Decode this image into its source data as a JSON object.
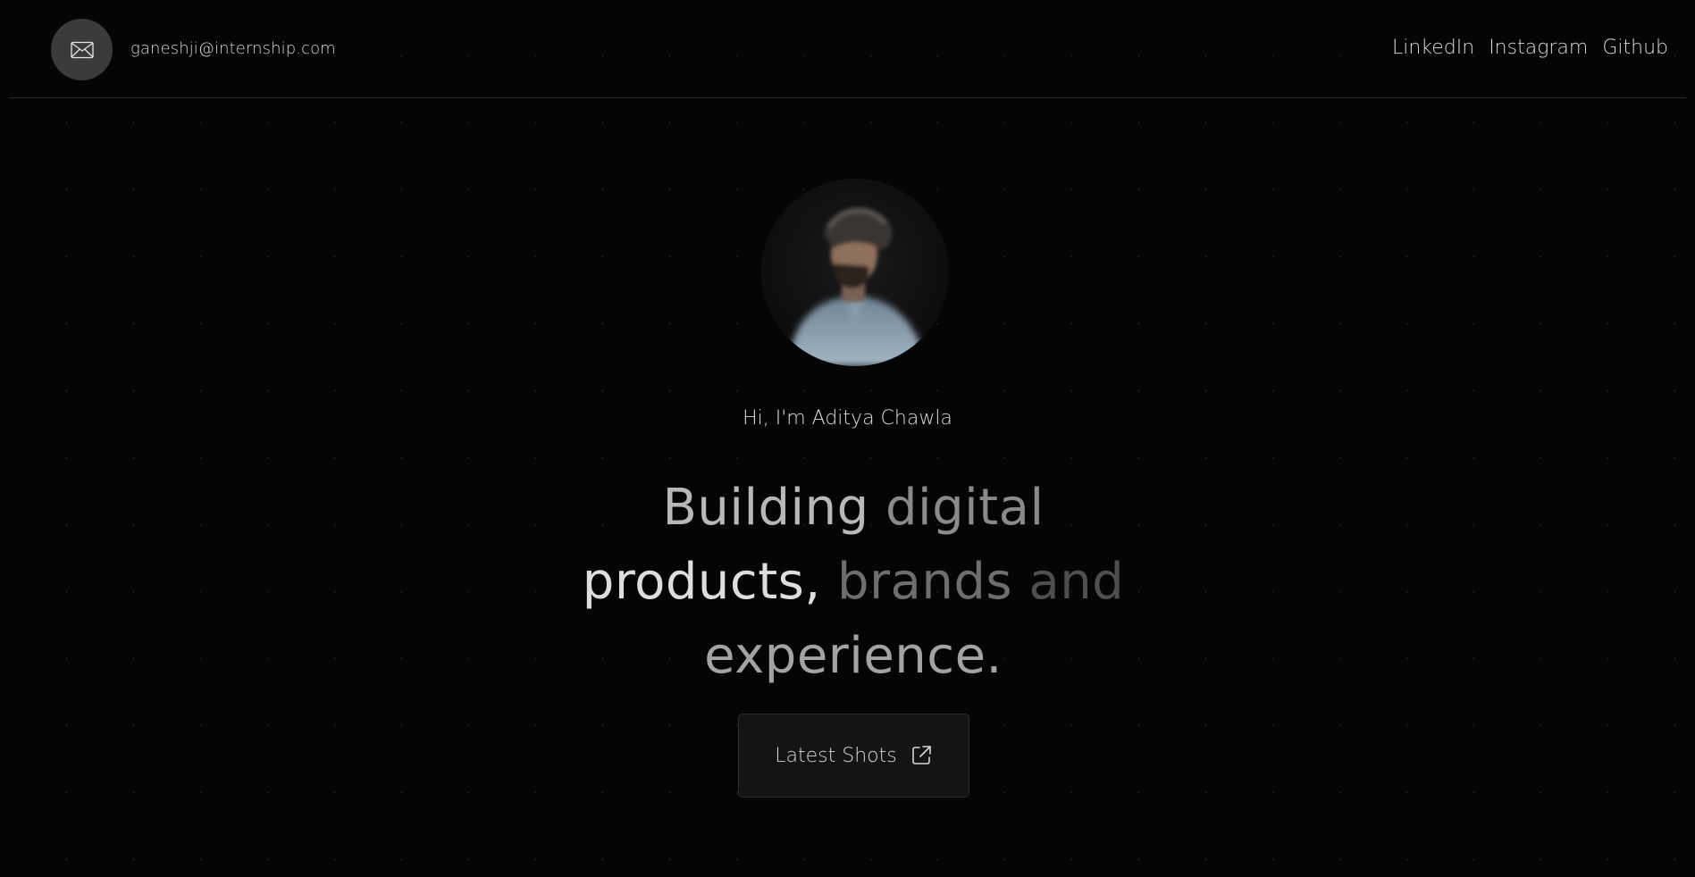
{
  "header": {
    "email": "ganeshji@internship.com",
    "mail_icon": "envelope-icon",
    "nav": [
      {
        "label": "LinkedIn"
      },
      {
        "label": "Instagram"
      },
      {
        "label": "Github"
      }
    ]
  },
  "hero": {
    "avatar_alt": "profile photo",
    "greeting": "Hi, I'm Aditya Chawla",
    "headline": {
      "part1": "Building",
      "part2": "digital",
      "part3": "products,",
      "part4": "brands",
      "part5": "and",
      "part6": "experience."
    },
    "cta_label": "Latest Shots",
    "cta_icon": "external-link-icon"
  },
  "colors": {
    "background": "#050505",
    "mail_button_bg": "#3b3b3b",
    "cta_bg": "#141414",
    "divider": "#2a2a2a"
  }
}
